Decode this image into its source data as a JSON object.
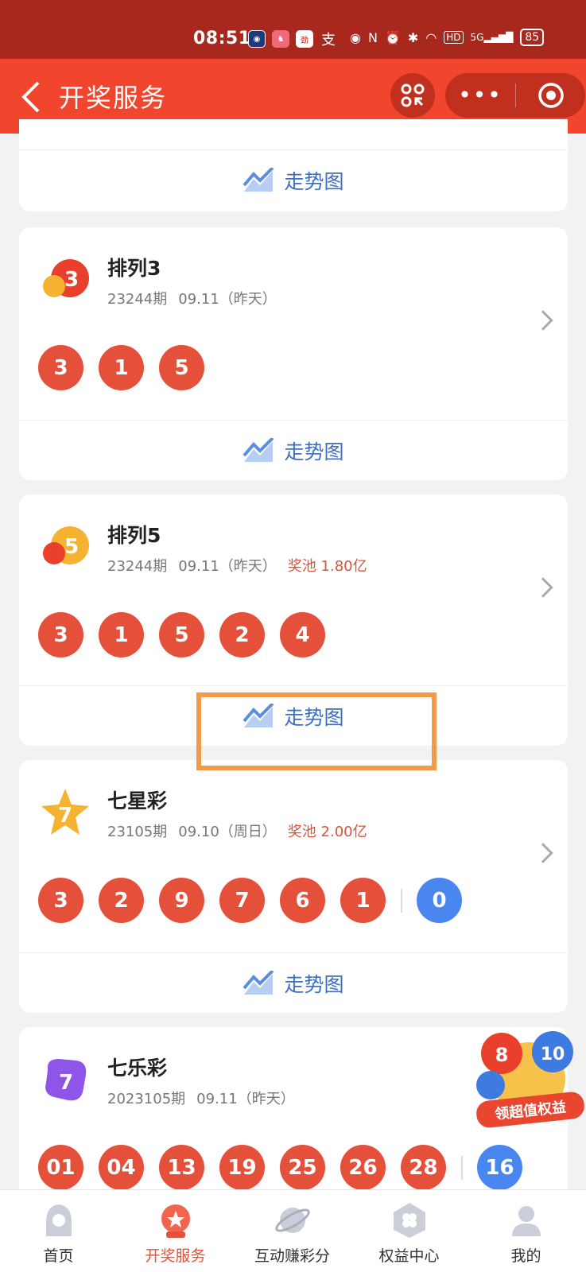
{
  "status_bar": {
    "time": "08:51",
    "network": "5G",
    "wifi": "HD",
    "battery": "85"
  },
  "nav": {
    "title": "开奖服务",
    "back_icon": "chevron-left-icon",
    "more_label": "•••"
  },
  "cards": [
    {
      "trend_label": "走势图"
    },
    {
      "name": "排列3",
      "issue": "23244期",
      "date": "09.11（昨天）",
      "pool": "",
      "balls": [
        "3",
        "1",
        "5"
      ],
      "trend_label": "走势图"
    },
    {
      "name": "排列5",
      "issue": "23244期",
      "date": "09.11（昨天）",
      "pool": "奖池 1.80亿",
      "balls": [
        "3",
        "1",
        "5",
        "2",
        "4"
      ],
      "trend_label": "走势图"
    },
    {
      "name": "七星彩",
      "issue": "23105期",
      "date": "09.10（周日）",
      "pool": "奖池 2.00亿",
      "balls": [
        "3",
        "2",
        "9",
        "7",
        "6",
        "1"
      ],
      "blue_balls": [
        "0"
      ],
      "trend_label": "走势图"
    },
    {
      "name": "七乐彩",
      "issue": "2023105期",
      "date": "09.11（昨天）",
      "pool": "",
      "balls": [
        "01",
        "04",
        "13",
        "19",
        "25",
        "26",
        "28"
      ],
      "blue_balls": [
        "16"
      ]
    }
  ],
  "promo": {
    "label": "领超值权益"
  },
  "tabs": [
    {
      "label": "首页",
      "icon": "home-icon"
    },
    {
      "label": "开奖服务",
      "icon": "lottery-icon",
      "active": true
    },
    {
      "label": "互动赚彩分",
      "icon": "planet-icon"
    },
    {
      "label": "权益中心",
      "icon": "clover-icon"
    },
    {
      "label": "我的",
      "icon": "profile-icon"
    }
  ],
  "colors": {
    "status_bar": "#a8281d",
    "nav_bar": "#f1452d",
    "red_ball": "#e4503a",
    "blue_ball": "#4a86f0",
    "trend_text": "#3c6fc2",
    "highlight": "#f2994a"
  }
}
